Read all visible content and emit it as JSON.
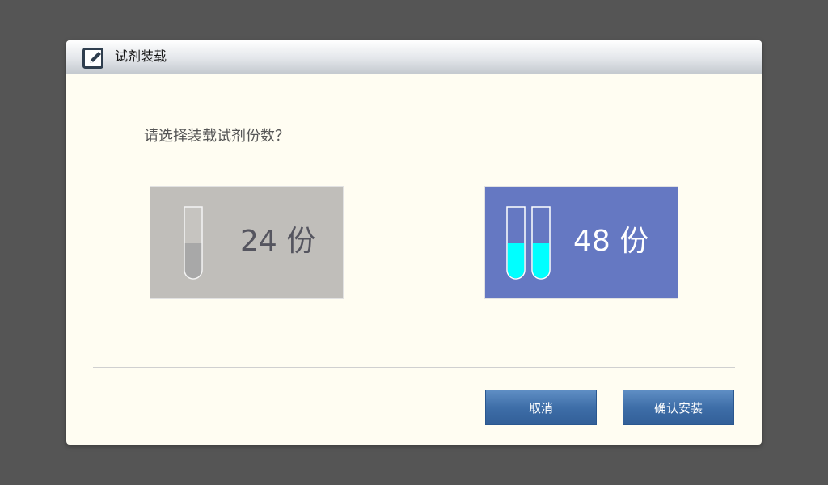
{
  "dialog": {
    "title": "试剂装载",
    "title_icon": "edit-icon",
    "prompt": "请选择装载试剂份数？"
  },
  "options": [
    {
      "label": "24 份",
      "selected": false,
      "tube_count": 1,
      "fill_level": 0.5,
      "background_color": "#c0beba",
      "tube_fill_color": "#a8a8a8",
      "text_color": "#55555f"
    },
    {
      "label": "48 份",
      "selected": true,
      "tube_count": 2,
      "fill_level": 0.5,
      "background_color": "#6578c2",
      "tube_fill_color": "#00ffff",
      "text_color": "#ffffff"
    }
  ],
  "buttons": {
    "cancel_label": "取消",
    "confirm_label": "确认安装"
  },
  "colors": {
    "overlay": "#555555",
    "dialog_background": "#fffdf2",
    "button_blue": "#3e6ea8"
  }
}
